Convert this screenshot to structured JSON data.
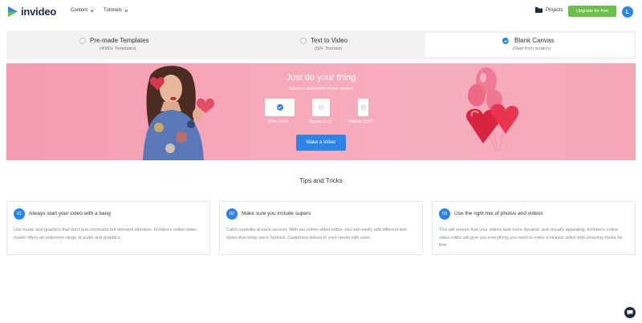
{
  "header": {
    "logo_text": "invideo",
    "nav": [
      {
        "label": "Content"
      },
      {
        "label": "Tutorials"
      }
    ],
    "projects_label": "Projects",
    "upgrade_label": "Upgrade for free",
    "avatar_initial": "L"
  },
  "options": [
    {
      "title": "Pre-made Templates",
      "subtitle": "(4000+ Templates)",
      "selected": false
    },
    {
      "title": "Text to Video",
      "subtitle": "(50+ Themes)",
      "selected": false
    },
    {
      "title": "Blank Canvas",
      "subtitle": "(Start from scratch)",
      "selected": true
    }
  ],
  "hero": {
    "title": "Just do your thing",
    "subtitle": "Select a dimension to get started",
    "dimensions": [
      {
        "label": "Wide (16:9)",
        "selected": true
      },
      {
        "label": "Square (1:1)",
        "selected": false
      },
      {
        "label": "Vertical (9:16)",
        "selected": false
      }
    ],
    "button_label": "Make a Video"
  },
  "tips": {
    "title": "Tips and Tricks",
    "cards": [
      {
        "number": "01",
        "title": "Always start your video with a bang",
        "body": "Use music and graphics that don't just command but demand attention. InVideo's online video maker offers an extensive range of audio and graphics."
      },
      {
        "number": "02",
        "title": "Make sure you include supers",
        "body": "Catch eyeballs at each second. With our online video editor, you can easily add different text styles that keep users hooked. Customize videos to your needs with ease."
      },
      {
        "number": "03",
        "title": "Use the right mix of photos and videos",
        "body": "This will ensure that your videos look more dynamic and visually appealing. InVideo's online video editor will give you everything you need to make a kickass video with amazing media for free."
      }
    ]
  },
  "colors": {
    "accent": "#2b84e6",
    "upgrade": "#6cc04a",
    "hero_pink": "#f7a9bb"
  },
  "icons": [
    "logo-icon",
    "chevron-down-icon",
    "folder-icon",
    "check-icon",
    "chat-icon"
  ]
}
